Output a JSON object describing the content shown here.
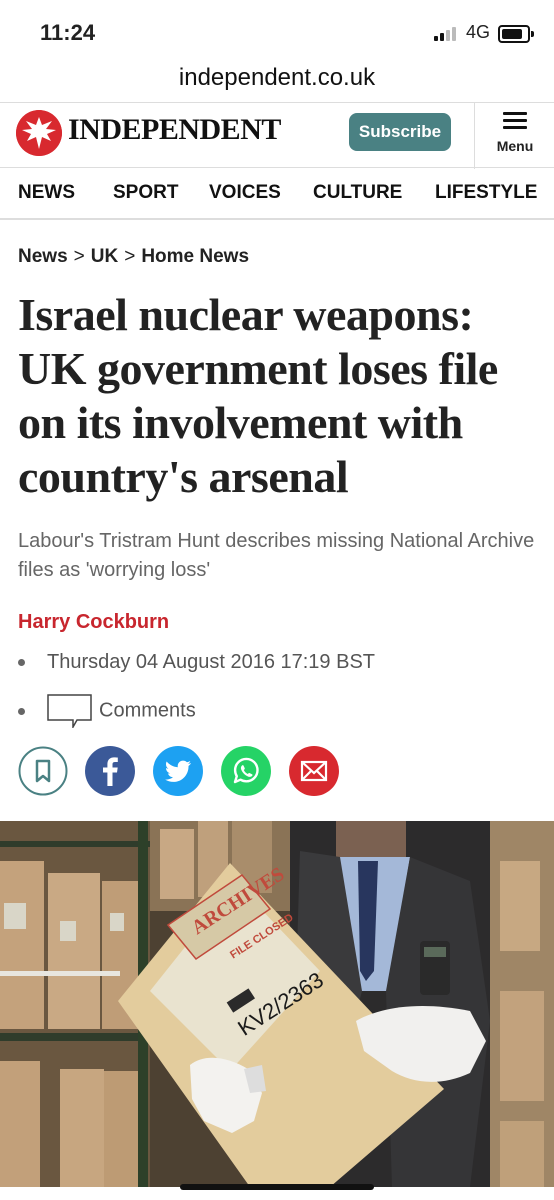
{
  "status": {
    "time": "11:24",
    "network": "4G"
  },
  "browser": {
    "url": "independent.co.uk"
  },
  "header": {
    "logo": "INDEPENDENT",
    "subscribe": "Subscribe",
    "menu": "Menu"
  },
  "nav": [
    {
      "label": "NEWS"
    },
    {
      "label": "SPORT"
    },
    {
      "label": "VOICES"
    },
    {
      "label": "CULTURE"
    },
    {
      "label": "LIFESTYLE"
    }
  ],
  "breadcrumb": {
    "items": [
      "News",
      "UK",
      "Home News"
    ],
    "separator": ">"
  },
  "article": {
    "headline": "Israel nuclear weapons: UK government loses file on its involvement with country's arsenal",
    "standfirst": "Labour's Tristram Hunt describes missing National Archive files as 'worrying loss'",
    "author": "Harry Cockburn",
    "date": "Thursday 04 August 2016 17:19 BST",
    "comments": "Comments"
  },
  "share_buttons": [
    {
      "icon": "bookmark-icon",
      "color": "#ffffff"
    },
    {
      "icon": "facebook-icon",
      "color": "#3b5998"
    },
    {
      "icon": "twitter-icon",
      "color": "#1da1f2"
    },
    {
      "icon": "whatsapp-icon",
      "color": "#25d366"
    },
    {
      "icon": "email-icon",
      "color": "#d8292f"
    }
  ],
  "photo": {
    "folder_stamp": "ARCHIVES",
    "folder_label": "FILE CLOSED",
    "reference": "KV2/2363"
  },
  "colors": {
    "brand": "#d8292f",
    "accent": "#4a8183",
    "author": "#c8262e"
  }
}
